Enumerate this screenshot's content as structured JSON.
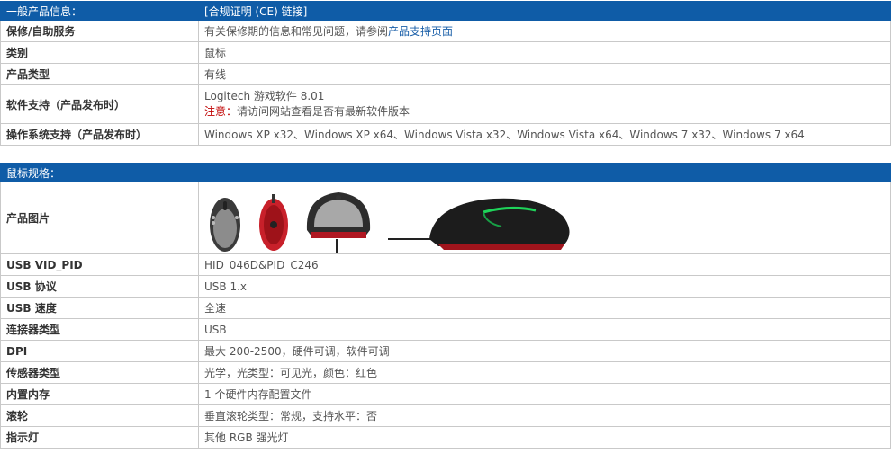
{
  "general": {
    "header_left": "一般产品信息：",
    "header_right": "[合规证明 (CE) 链接]",
    "rows": {
      "warranty": {
        "label": "保修/自助服务",
        "text": "有关保修期的信息和常见问题，请参阅",
        "link": "产品支持页面"
      },
      "category": {
        "label": "类别",
        "value": "鼠标"
      },
      "type": {
        "label": "产品类型",
        "value": "有线"
      },
      "software": {
        "label": "软件支持（产品发布时）",
        "line1": "Logitech 游戏软件 8.01",
        "note_label": "注意：",
        "note_text": "请访问网站查看是否有最新软件版本"
      },
      "os": {
        "label": "操作系统支持（产品发布时）",
        "value": "Windows XP x32、Windows XP x64、Windows Vista x32、Windows Vista x64、Windows 7 x32、Windows 7 x64"
      }
    }
  },
  "mouse": {
    "header_left": "鼠标规格：",
    "images_label": "产品图片",
    "image_icons": [
      "mouse-top-view-icon",
      "mouse-bottom-view-icon",
      "mouse-front-view-icon",
      "mouse-side-view-icon"
    ],
    "rows": [
      {
        "label": "USB VID_PID",
        "value": "HID_046D&PID_C246"
      },
      {
        "label": "USB 协议",
        "value": "USB 1.x"
      },
      {
        "label": "USB 速度",
        "value": "全速"
      },
      {
        "label": "连接器类型",
        "value": "USB"
      },
      {
        "label": "DPI",
        "value": "最大 200-2500，硬件可调，软件可调"
      },
      {
        "label": "传感器类型",
        "value": "光学，光类型：可见光，颜色：红色"
      },
      {
        "label": "内置内存",
        "value": "1 个硬件内存配置文件"
      },
      {
        "label": "滚轮",
        "value": "垂直滚轮类型：常规，支持水平：否"
      },
      {
        "label": "指示灯",
        "value": "其他 RGB 强光灯"
      }
    ]
  }
}
